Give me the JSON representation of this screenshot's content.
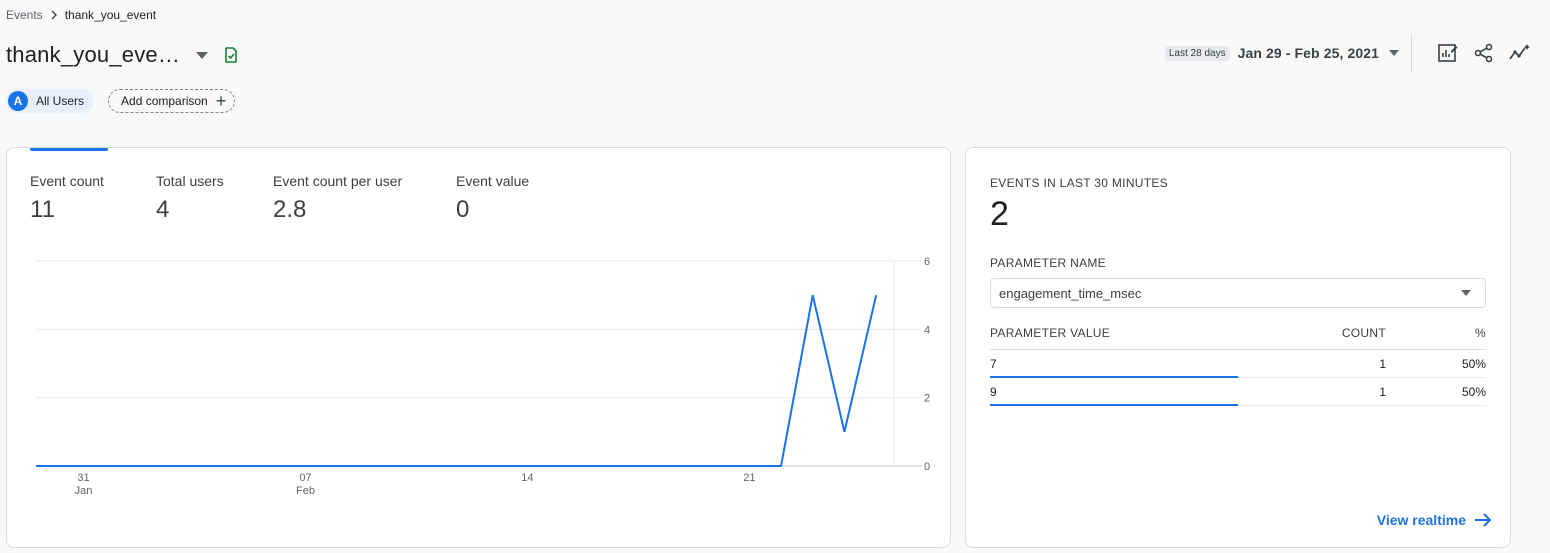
{
  "breadcrumb": {
    "parent": "Events",
    "current": "thank_you_event"
  },
  "title": "thank_you_eve…",
  "chips": {
    "avatar_letter": "A",
    "all_users": "All Users",
    "add_comparison": "Add comparison"
  },
  "date": {
    "tag": "Last 28 days",
    "range": "Jan 29 - Feb 25, 2021"
  },
  "toolbar_icons": [
    "customize-report-icon",
    "share-icon",
    "insights-icon"
  ],
  "metrics": [
    {
      "label": "Event count",
      "value": "11"
    },
    {
      "label": "Total users",
      "value": "4"
    },
    {
      "label": "Event count per user",
      "value": "2.8"
    },
    {
      "label": "Event value",
      "value": "0"
    }
  ],
  "chart_data": {
    "type": "line",
    "series": [
      {
        "values": [
          0,
          0,
          0,
          0,
          0,
          0,
          0,
          0,
          0,
          0,
          0,
          0,
          0,
          0,
          0,
          0,
          0,
          0,
          0,
          0,
          0,
          0,
          0,
          0,
          5,
          1,
          5
        ]
      }
    ],
    "x": [
      "Jan 30",
      "Jan 31",
      "Feb 1",
      "Feb 2",
      "Feb 3",
      "Feb 4",
      "Feb 5",
      "Feb 6",
      "Feb 7",
      "Feb 8",
      "Feb 9",
      "Feb 10",
      "Feb 11",
      "Feb 12",
      "Feb 13",
      "Feb 14",
      "Feb 15",
      "Feb 16",
      "Feb 17",
      "Feb 18",
      "Feb 19",
      "Feb 20",
      "Feb 21",
      "Feb 22",
      "Feb 23",
      "Feb 24",
      "Feb 25"
    ],
    "x_ticks": [
      {
        "index": 1,
        "label": "31",
        "sub": "Jan"
      },
      {
        "index": 8,
        "label": "07",
        "sub": "Feb"
      },
      {
        "index": 15,
        "label": "14",
        "sub": ""
      },
      {
        "index": 22,
        "label": "21",
        "sub": ""
      }
    ],
    "y_ticks": [
      0,
      2,
      4,
      6
    ],
    "ylim": [
      0,
      6
    ],
    "color": "#1a73e8",
    "grid": true
  },
  "realtime": {
    "label": "EVENTS IN LAST 30 MINUTES",
    "value": "2",
    "param_label": "PARAMETER NAME",
    "param_selected": "engagement_time_msec",
    "table_headers": {
      "value": "PARAMETER VALUE",
      "count": "COUNT",
      "pct": "%"
    },
    "rows": [
      {
        "value": "7",
        "count": "1",
        "pct": "50%",
        "share": 0.5
      },
      {
        "value": "9",
        "count": "1",
        "pct": "50%",
        "share": 0.5
      }
    ],
    "link": "View realtime"
  },
  "colors": {
    "accent": "#1a73e8",
    "check": "#188038"
  }
}
